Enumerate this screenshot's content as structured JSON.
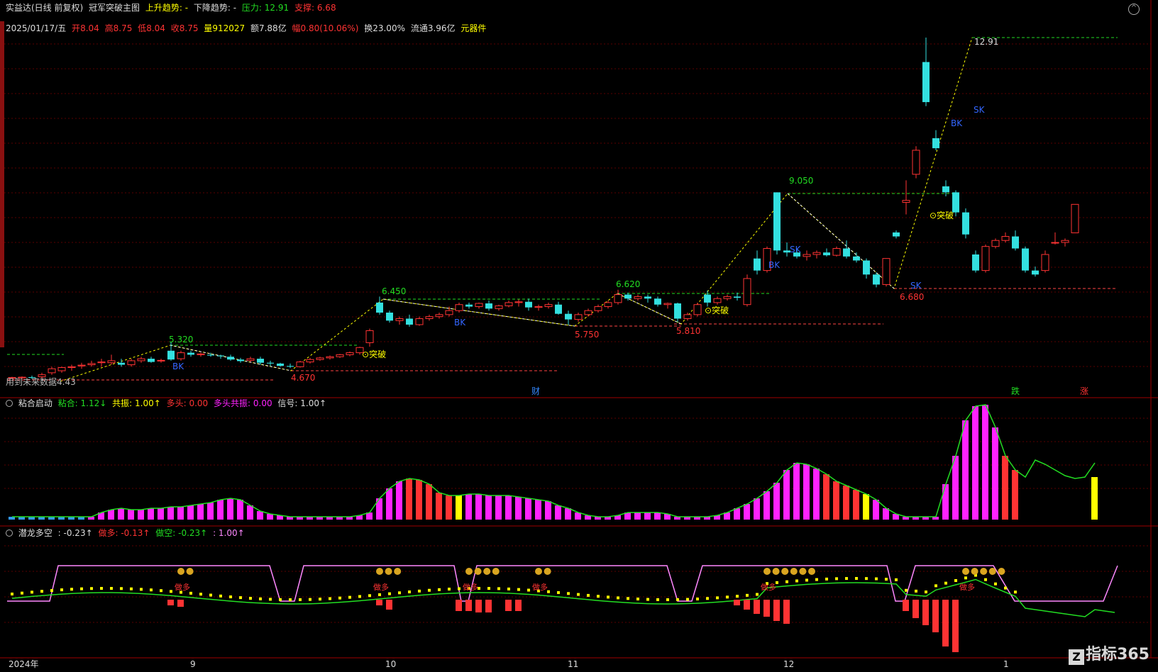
{
  "title_bar": {
    "stock": "实益达(日线 前复权)",
    "indicator": "冠军突破主图",
    "up_trend": "上升趋势: -",
    "down_trend": "下降趋势: -",
    "pressure_label": "压力:",
    "pressure": "12.91",
    "support_label": "支撑:",
    "support": "6.68"
  },
  "quote_line": {
    "date": "2025/01/17/五",
    "open_label": "开",
    "open": "8.04",
    "high_label": "高",
    "high": "8.75",
    "low_label": "低",
    "low": "8.04",
    "close_label": "收",
    "close": "8.75",
    "vol_label": "量",
    "vol": "912027",
    "amount_label": "额",
    "amount": "7.88亿",
    "change_label": "幅",
    "change": "0.80(10.06%)",
    "turnover": "换23.00%",
    "float": "流通3.96亿",
    "sector": "元器件"
  },
  "main_labels": {
    "peak_1291": "12.91",
    "p9050": "9.050",
    "p6620": "6.620",
    "p6450": "6.450",
    "p5320": "5.320",
    "p5750": "5.750",
    "p5810": "5.810",
    "p4670": "4.670",
    "p6680": "6.680",
    "p443": "用到未来数据4.43",
    "breakout": "突破",
    "sk": "SK",
    "bk": "BK",
    "cai": "财",
    "die": "跌",
    "zhang": "涨"
  },
  "panel2": {
    "name": "粘合启动",
    "nianhe": "粘合: 1.12↓",
    "gongzhen": "共振: 1.00↑",
    "duotou": "多头: 0.00",
    "duotou_gongzhen": "多头共振: 0.00",
    "xinhao": "信号: 1.00↑"
  },
  "panel3": {
    "name": "潜龙多空",
    "v1": ": -0.23↑",
    "zuoduo": "做多: -0.13↑",
    "zuokong": "做空: -0.23↑",
    "v4": ": 1.00↑",
    "zuoduo_tag": "做多"
  },
  "axis": {
    "labels": [
      "2024年",
      "9",
      "10",
      "11",
      "12",
      "1"
    ]
  },
  "brand": {
    "name": "指标365",
    "mark": "Z"
  },
  "colors": {
    "up": "#ff3333",
    "down": "#33e0e0",
    "green": "#22dd22",
    "yellow": "#ffff00",
    "magenta": "#ff22ff",
    "pink_line": "#ff88ff",
    "grid": "#5a0000"
  },
  "chart_data": {
    "type": "candlestick",
    "candles": [
      [
        4.43,
        4.45,
        4.4,
        4.43
      ],
      [
        4.42,
        4.46,
        4.4,
        4.44
      ],
      [
        4.44,
        4.48,
        4.4,
        4.42
      ],
      [
        4.45,
        4.55,
        4.4,
        4.5
      ],
      [
        4.55,
        4.7,
        4.5,
        4.65
      ],
      [
        4.6,
        4.7,
        4.55,
        4.68
      ],
      [
        4.68,
        4.75,
        4.6,
        4.7
      ],
      [
        4.72,
        4.8,
        4.65,
        4.74
      ],
      [
        4.75,
        4.85,
        4.7,
        4.78
      ],
      [
        4.8,
        4.9,
        4.7,
        4.82
      ],
      [
        4.8,
        5.0,
        4.75,
        4.85
      ],
      [
        4.8,
        4.9,
        4.7,
        4.75
      ],
      [
        4.75,
        4.9,
        4.7,
        4.85
      ],
      [
        4.85,
        4.95,
        4.8,
        4.9
      ],
      [
        4.9,
        4.95,
        4.8,
        4.82
      ],
      [
        4.85,
        4.9,
        4.8,
        4.86
      ],
      [
        5.1,
        5.32,
        4.85,
        4.88
      ],
      [
        4.9,
        5.1,
        4.85,
        5.05
      ],
      [
        5.05,
        5.1,
        4.95,
        5.0
      ],
      [
        5.0,
        5.05,
        4.95,
        5.02
      ],
      [
        5.0,
        5.05,
        4.95,
        4.98
      ],
      [
        4.98,
        5.0,
        4.9,
        4.96
      ],
      [
        4.95,
        5.0,
        4.85,
        4.88
      ],
      [
        4.88,
        4.92,
        4.8,
        4.84
      ],
      [
        4.86,
        4.95,
        4.82,
        4.9
      ],
      [
        4.9,
        4.95,
        4.75,
        4.8
      ],
      [
        4.8,
        4.85,
        4.72,
        4.78
      ],
      [
        4.78,
        4.8,
        4.7,
        4.72
      ],
      [
        4.72,
        4.78,
        4.67,
        4.7
      ],
      [
        4.7,
        4.85,
        4.68,
        4.82
      ],
      [
        4.82,
        4.92,
        4.78,
        4.88
      ],
      [
        4.88,
        4.95,
        4.85,
        4.92
      ],
      [
        4.92,
        4.98,
        4.88,
        4.95
      ],
      [
        4.95,
        5.02,
        4.92,
        5.0
      ],
      [
        5.0,
        5.08,
        4.96,
        5.05
      ],
      [
        5.05,
        5.2,
        5.0,
        5.18
      ],
      [
        5.3,
        5.65,
        5.2,
        5.6
      ],
      [
        6.3,
        6.45,
        6.0,
        6.05
      ],
      [
        6.05,
        6.1,
        5.8,
        5.85
      ],
      [
        5.85,
        5.95,
        5.75,
        5.9
      ],
      [
        5.9,
        6.0,
        5.7,
        5.75
      ],
      [
        5.75,
        5.95,
        5.72,
        5.9
      ],
      [
        5.9,
        6.0,
        5.85,
        5.95
      ],
      [
        5.95,
        6.05,
        5.9,
        6.0
      ],
      [
        6.0,
        6.2,
        5.95,
        6.1
      ],
      [
        6.1,
        6.3,
        6.05,
        6.25
      ],
      [
        6.25,
        6.3,
        6.15,
        6.2
      ],
      [
        6.2,
        6.3,
        6.15,
        6.28
      ],
      [
        6.28,
        6.35,
        6.1,
        6.15
      ],
      [
        6.15,
        6.25,
        6.1,
        6.22
      ],
      [
        6.22,
        6.35,
        6.18,
        6.3
      ],
      [
        6.3,
        6.38,
        6.2,
        6.32
      ],
      [
        6.32,
        6.4,
        6.1,
        6.18
      ],
      [
        6.18,
        6.25,
        6.1,
        6.2
      ],
      [
        6.2,
        6.3,
        6.15,
        6.25
      ],
      [
        6.25,
        6.32,
        6.0,
        6.02
      ],
      [
        6.02,
        6.1,
        5.75,
        5.88
      ],
      [
        5.88,
        6.05,
        5.82,
        6.0
      ],
      [
        6.0,
        6.15,
        5.95,
        6.1
      ],
      [
        6.1,
        6.25,
        6.05,
        6.2
      ],
      [
        6.2,
        6.35,
        6.15,
        6.3
      ],
      [
        6.3,
        6.62,
        6.25,
        6.5
      ],
      [
        6.5,
        6.55,
        6.35,
        6.4
      ],
      [
        6.4,
        6.5,
        6.35,
        6.45
      ],
      [
        6.45,
        6.5,
        6.3,
        6.4
      ],
      [
        6.4,
        6.45,
        6.2,
        6.25
      ],
      [
        6.25,
        6.3,
        6.15,
        6.28
      ],
      [
        6.28,
        6.3,
        5.81,
        5.9
      ],
      [
        5.9,
        6.05,
        5.85,
        6.0
      ],
      [
        6.0,
        6.3,
        5.95,
        6.25
      ],
      [
        6.5,
        6.6,
        6.2,
        6.3
      ],
      [
        6.3,
        6.45,
        6.25,
        6.4
      ],
      [
        6.4,
        6.5,
        6.35,
        6.45
      ],
      [
        6.45,
        6.55,
        6.35,
        6.42
      ],
      [
        6.25,
        7.0,
        6.2,
        6.9
      ],
      [
        7.4,
        7.6,
        7.0,
        7.1
      ],
      [
        7.1,
        7.7,
        7.05,
        7.65
      ],
      [
        9.05,
        9.05,
        7.5,
        7.6
      ],
      [
        7.6,
        7.8,
        7.45,
        7.55
      ],
      [
        7.55,
        7.65,
        7.4,
        7.45
      ],
      [
        7.45,
        7.6,
        7.35,
        7.5
      ],
      [
        7.5,
        7.6,
        7.4,
        7.55
      ],
      [
        7.55,
        7.65,
        7.45,
        7.48
      ],
      [
        7.48,
        7.7,
        7.45,
        7.65
      ],
      [
        7.65,
        7.85,
        7.4,
        7.45
      ],
      [
        7.45,
        7.55,
        7.3,
        7.35
      ],
      [
        7.35,
        7.4,
        6.9,
        7.0
      ],
      [
        7.0,
        7.05,
        6.68,
        6.75
      ],
      [
        6.75,
        7.4,
        6.7,
        7.4
      ],
      [
        8.05,
        8.1,
        7.9,
        7.95
      ],
      [
        8.8,
        9.35,
        8.5,
        8.85
      ],
      [
        9.5,
        10.2,
        9.4,
        10.1
      ],
      [
        12.3,
        12.91,
        11.2,
        11.3
      ],
      [
        10.4,
        10.6,
        10.1,
        10.15
      ],
      [
        9.2,
        9.35,
        8.95,
        9.05
      ],
      [
        9.05,
        9.1,
        8.45,
        8.55
      ],
      [
        8.55,
        8.65,
        7.9,
        8.0
      ],
      [
        7.5,
        7.6,
        7.05,
        7.1
      ],
      [
        7.1,
        7.75,
        7.05,
        7.7
      ],
      [
        7.7,
        7.9,
        7.65,
        7.85
      ],
      [
        7.85,
        8.05,
        7.8,
        7.95
      ],
      [
        7.95,
        8.1,
        7.6,
        7.65
      ],
      [
        7.65,
        7.7,
        7.05,
        7.1
      ],
      [
        7.1,
        7.2,
        6.95,
        7.0
      ],
      [
        7.1,
        7.6,
        7.05,
        7.5
      ],
      [
        7.8,
        8.05,
        7.75,
        7.8
      ],
      [
        7.8,
        7.9,
        7.7,
        7.85
      ],
      [
        8.04,
        8.75,
        8.04,
        8.75
      ]
    ]
  }
}
